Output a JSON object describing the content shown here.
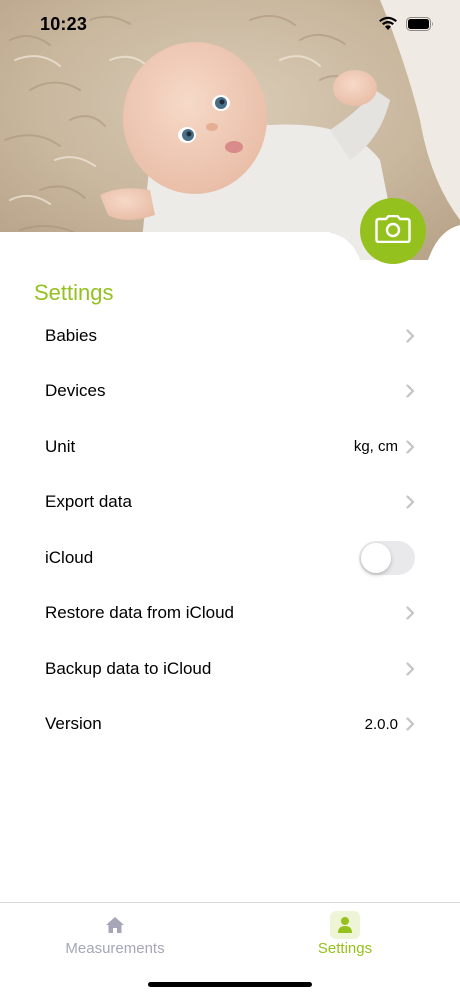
{
  "status_bar": {
    "time": "10:23",
    "icons": [
      "wifi-icon",
      "battery-icon"
    ]
  },
  "hero": {
    "description_icon": "baby-photo",
    "camera_icon": "camera-icon"
  },
  "settings": {
    "title": "Settings",
    "rows": [
      {
        "label": "Babies",
        "value": "",
        "control": "chevron"
      },
      {
        "label": "Devices",
        "value": "",
        "control": "chevron"
      },
      {
        "label": "Unit",
        "value": "kg, cm",
        "control": "chevron"
      },
      {
        "label": "Export data",
        "value": "",
        "control": "chevron"
      },
      {
        "label": "iCloud",
        "value": "",
        "control": "toggle",
        "toggle_on": false
      },
      {
        "label": "Restore data from iCloud",
        "value": "",
        "control": "chevron"
      },
      {
        "label": "Backup data to iCloud",
        "value": "",
        "control": "chevron"
      },
      {
        "label": "Version",
        "value": "2.0.0",
        "control": "chevron"
      }
    ]
  },
  "tab_bar": {
    "tabs": [
      {
        "label": "Measurements",
        "icon": "home-icon",
        "active": false
      },
      {
        "label": "Settings",
        "icon": "person-icon",
        "active": true
      }
    ]
  },
  "colors": {
    "accent": "#95c11f",
    "accent_light": "#eef5d6",
    "inactive_tab": "#a6a6b8",
    "chevron": "#c4c4c7",
    "toggle_off": "#e9e9eb"
  }
}
